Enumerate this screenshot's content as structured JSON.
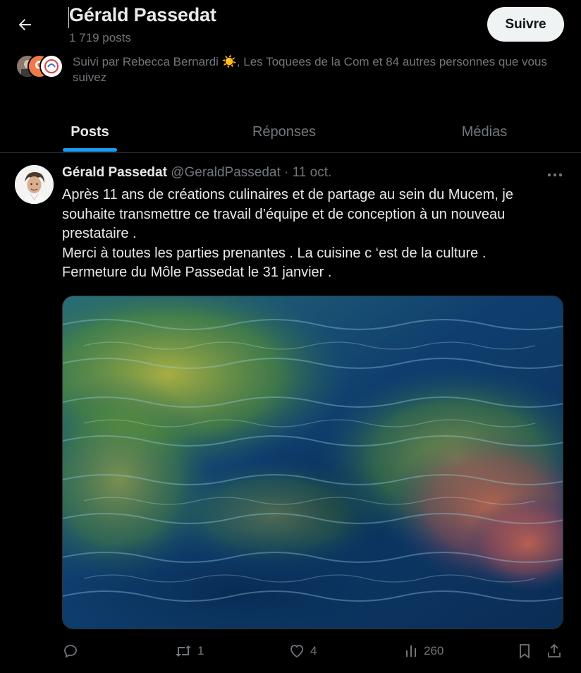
{
  "header": {
    "title": "Gérald Passedat",
    "post_count": "1 719 posts",
    "follow_label": "Suivre"
  },
  "followed_by": {
    "text": "Suivi par Rebecca Bernardi ☀️, Les Toquees de la Com et 84 autres personnes que vous suivez"
  },
  "tabs": [
    {
      "label": "Posts",
      "active": true
    },
    {
      "label": "Réponses",
      "active": false
    },
    {
      "label": "Médias",
      "active": false
    }
  ],
  "tweet": {
    "author_name": "Gérald Passedat",
    "handle": "@GeraldPassedat",
    "separator": "·",
    "date": "11 oct.",
    "lines": [
      "Après 11 ans de créations culinaires et de partage au sein du Mucem, je souhaite transmettre ce travail d’équipe et de conception à un nouveau prestataire .",
      "Merci à toutes les parties prenantes . La cuisine c ‘est de la culture .",
      "Fermeture du Môle Passedat le 31 janvier ."
    ],
    "media_description_icon": "sea-water-photo",
    "actions": {
      "replies": "",
      "retweets": "1",
      "likes": "4",
      "views": "260"
    }
  },
  "colors": {
    "accent": "#1d9bf0",
    "background": "#000000",
    "secondary_text": "#71767b",
    "primary_text": "#e7e9ea"
  }
}
